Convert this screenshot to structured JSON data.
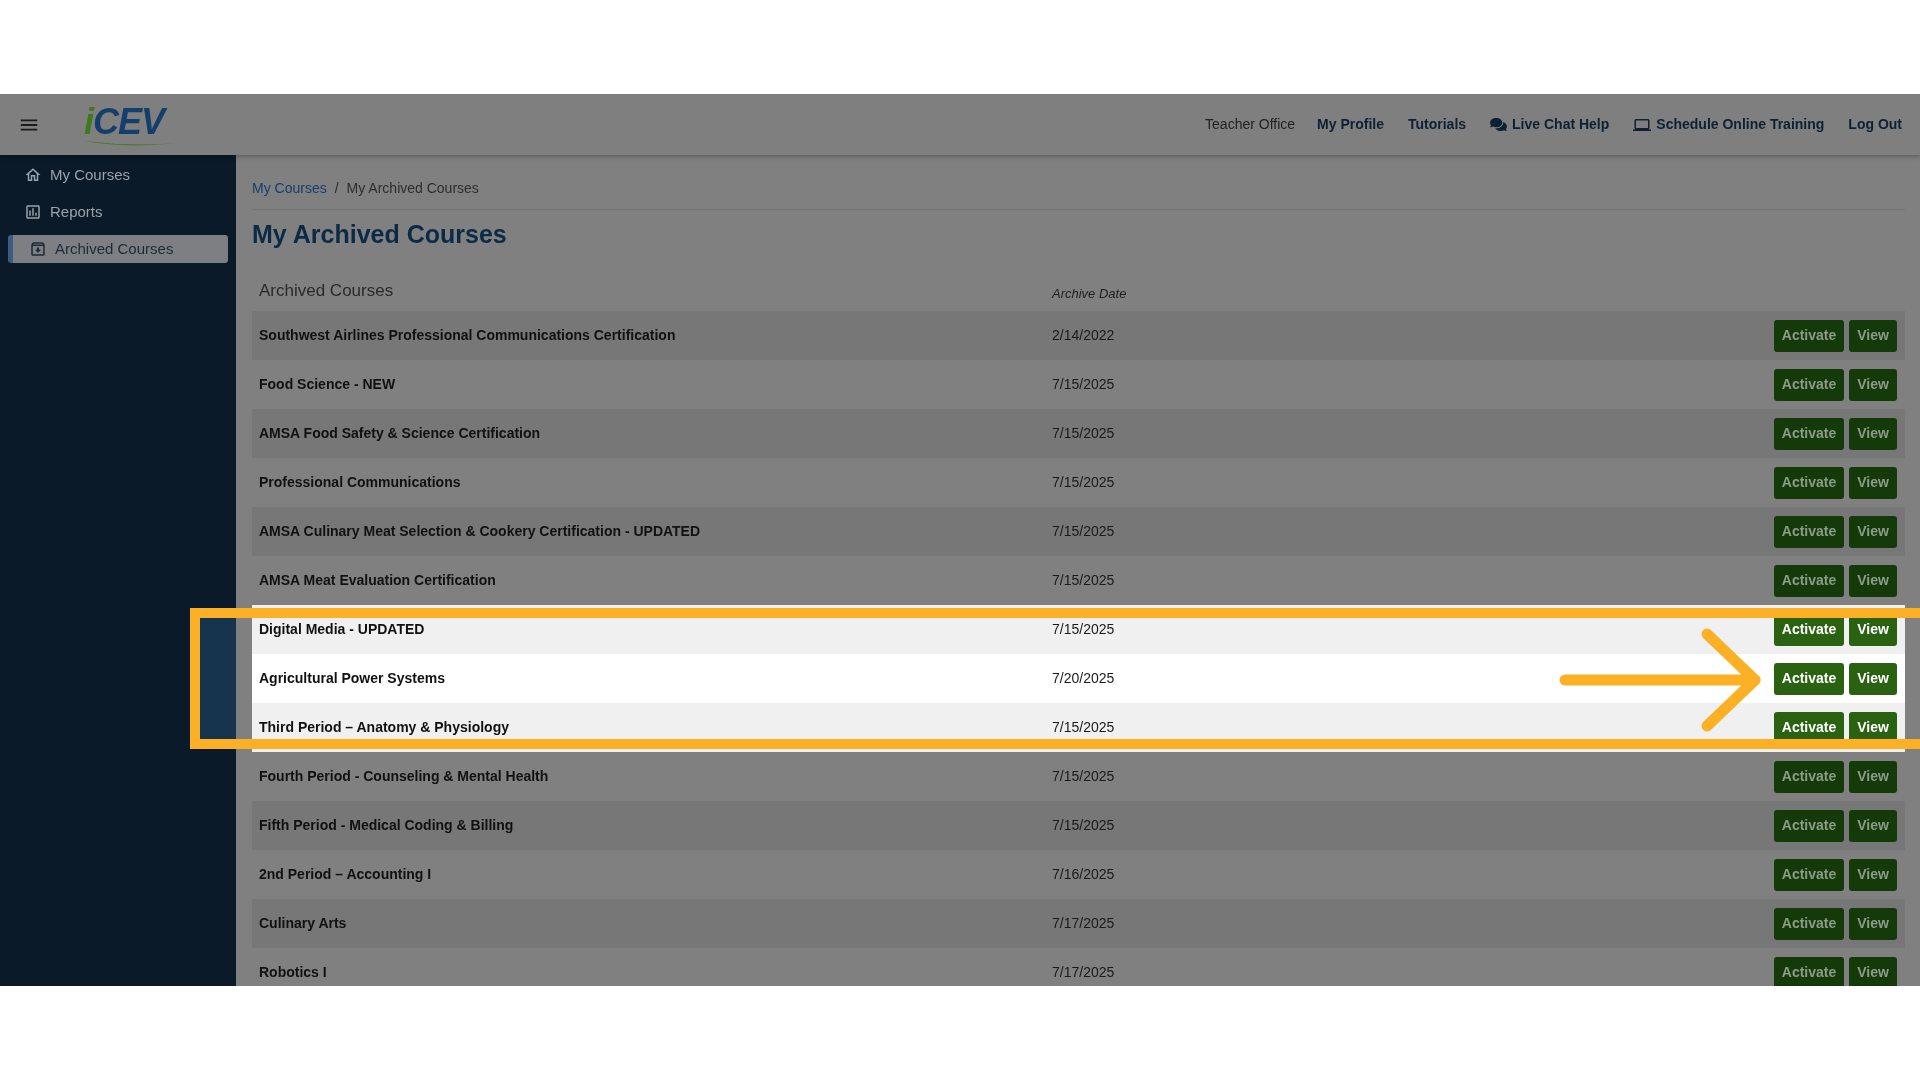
{
  "header": {
    "logo": "iCEV",
    "nav": [
      {
        "label": "Teacher Office",
        "kind": "plain"
      },
      {
        "label": "My Profile",
        "kind": "link"
      },
      {
        "label": "Tutorials",
        "kind": "link"
      },
      {
        "label": "Live Chat Help",
        "kind": "chat"
      },
      {
        "label": "Schedule Online Training",
        "kind": "training"
      },
      {
        "label": "Log Out",
        "kind": "link"
      }
    ]
  },
  "sidebar": {
    "items": [
      {
        "label": "My Courses",
        "kind": "home",
        "selected": false
      },
      {
        "label": "Reports",
        "kind": "reports",
        "selected": false
      },
      {
        "label": "Archived Courses",
        "kind": "archive",
        "selected": true
      }
    ]
  },
  "breadcrumb": [
    {
      "label": "My Courses",
      "kind": "link"
    },
    {
      "label": "/",
      "kind": "separator"
    },
    {
      "label": "My Archived Courses",
      "kind": "current"
    }
  ],
  "title": "My Archived Courses",
  "table": {
    "columns": [
      "Archived Courses",
      "Archive Date"
    ],
    "rows": [
      {
        "name": "Southwest Airlines Professional Communications Certification",
        "date": "2/14/2022",
        "highlighted": false,
        "buttons": [
          "Activate",
          "View"
        ]
      },
      {
        "name": "Food Science - NEW",
        "date": "7/15/2025",
        "highlighted": false,
        "buttons": [
          "Activate",
          "View"
        ]
      },
      {
        "name": "AMSA Food Safety & Science Certification",
        "date": "7/15/2025",
        "highlighted": false,
        "buttons": [
          "Activate",
          "View"
        ]
      },
      {
        "name": "Professional Communications",
        "date": "7/15/2025",
        "highlighted": false,
        "buttons": [
          "Activate",
          "View"
        ]
      },
      {
        "name": "AMSA Culinary Meat Selection & Cookery Certification - UPDATED",
        "date": "7/15/2025",
        "highlighted": false,
        "buttons": [
          "Activate",
          "View"
        ]
      },
      {
        "name": "AMSA Meat Evaluation Certification",
        "date": "7/15/2025",
        "highlighted": false,
        "buttons": [
          "Activate",
          "View"
        ]
      },
      {
        "name": "Digital Media - UPDATED",
        "date": "7/15/2025",
        "highlighted": true,
        "buttons": [
          "Activate",
          "View"
        ]
      },
      {
        "name": "Agricultural Power Systems",
        "date": "7/20/2025",
        "highlighted": true,
        "buttons": [
          "Activate",
          "View"
        ]
      },
      {
        "name": "Third Period – Anatomy & Physiology",
        "date": "7/15/2025",
        "highlighted": true,
        "buttons": [
          "Activate",
          "View"
        ]
      },
      {
        "name": "Fourth Period - Counseling & Mental Health",
        "date": "7/15/2025",
        "highlighted": false,
        "buttons": [
          "Activate",
          "View"
        ]
      },
      {
        "name": "Fifth Period - Medical Coding & Billing",
        "date": "7/15/2025",
        "highlighted": false,
        "buttons": [
          "Activate",
          "View"
        ]
      },
      {
        "name": "2nd Period – Accounting I",
        "date": "7/16/2025",
        "highlighted": false,
        "buttons": [
          "Activate",
          "View"
        ]
      },
      {
        "name": "Culinary Arts",
        "date": "7/17/2025",
        "highlighted": false,
        "buttons": [
          "Activate",
          "View"
        ]
      },
      {
        "name": "Robotics I",
        "date": "7/17/2025",
        "highlighted": false,
        "buttons": [
          "Activate",
          "View"
        ]
      }
    ]
  }
}
